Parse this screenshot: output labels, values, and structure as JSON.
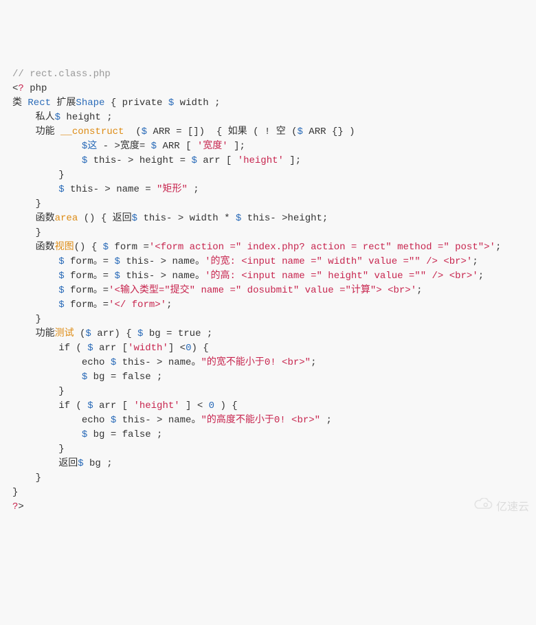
{
  "code": {
    "l01": "// rect.class.php",
    "l02a": "<",
    "l02b": "?",
    "l02c": " php",
    "l03a": "类 ",
    "l03b": "Rect",
    "l03c": " 扩展",
    "l03d": "Shape",
    "l03e": " { private ",
    "l03f": "$",
    "l03g": " width ;",
    "l04a": "    私人",
    "l04b": "$",
    "l04c": " height ;",
    "l05a": "    功能 ",
    "l05b": "__construct ",
    "l05c": " (",
    "l05d": "$",
    "l05e": " ARR = [])  { 如果 ( ! 空 (",
    "l05f": "$",
    "l05g": " ARR {} )",
    "l06a": "            ",
    "l06b": "$这",
    "l06c": " - >宽度= ",
    "l06d": "$",
    "l06e": " ARR [ ",
    "l06f": "'宽度'",
    "l06g": " ];",
    "l07a": "            ",
    "l07b": "$",
    "l07c": " this- > height = ",
    "l07d": "$",
    "l07e": " arr [ ",
    "l07f": "'height'",
    "l07g": " ];",
    "l08": "",
    "l09": "",
    "l10": "        }",
    "l11a": "        ",
    "l11b": "$",
    "l11c": " this- > name = ",
    "l11d": "\"矩形\"",
    "l11e": " ;",
    "l12": "    }",
    "l13a": "    函数",
    "l13b": "area",
    "l13c": " () { 返回",
    "l13d": "$",
    "l13e": " this- > width * ",
    "l13f": "$",
    "l13g": " this- >height;",
    "l14": "",
    "l15": "    }",
    "l16a": "    函数",
    "l16b": "视图",
    "l16c": "() { ",
    "l16d": "$",
    "l16e": " form =",
    "l16f": "'<form action =\" index.php? action = rect\" method =\" post\">'",
    "l16g": ";",
    "l17a": "        ",
    "l17b": "$",
    "l17c": " form。= ",
    "l17d": "$",
    "l17e": " this- > name。",
    "l17f": "'的宽: <input name =\" width\" value =\"\" /> <br>'",
    "l17g": ";",
    "l18a": "        ",
    "l18b": "$",
    "l18c": " form。= ",
    "l18d": "$",
    "l18e": " this- > name。",
    "l18f": "'的高: <input name =\" height\" value =\"\" /> <br>'",
    "l18g": ";",
    "l19a": "        ",
    "l19b": "$",
    "l19c": " form。=",
    "l19d": "'<输入类型=\"提交\" name =\" dosubmit\" value =\"计算\"> <br>'",
    "l19e": ";",
    "l20a": "        ",
    "l20b": "$",
    "l20c": " form。=",
    "l20d": "'</ form>'",
    "l20e": ";",
    "l21": "",
    "l22": "",
    "l23": "    }",
    "l24a": "    功能",
    "l24b": "测试 ",
    "l24c": "(",
    "l24d": "$",
    "l24e": " arr) { ",
    "l24f": "$",
    "l24g": " bg = true ;",
    "l25a": "        if ( ",
    "l25b": "$",
    "l25c": " arr [",
    "l25d": "'width'",
    "l25e": "] <",
    "l25f": "0",
    "l25g": ") {",
    "l26a": "            echo ",
    "l26b": "$",
    "l26c": " this- > name。",
    "l26d": "\"的宽不能小于0! <br>\"",
    "l26e": ";",
    "l27a": "            ",
    "l27b": "$",
    "l27c": " bg = false ;",
    "l28": "",
    "l29": "        }",
    "l30a": "        if ( ",
    "l30b": "$",
    "l30c": " arr [ ",
    "l30d": "'height'",
    "l30e": " ] < ",
    "l30f": "0",
    "l30g": " ) {",
    "l31a": "            echo ",
    "l31b": "$",
    "l31c": " this- > name。",
    "l31d": "\"的高度不能小于0! <br>\"",
    "l31e": " ;",
    "l32a": "            ",
    "l32b": "$",
    "l32c": " bg = false ;",
    "l33": "        }",
    "l34a": "        返回",
    "l34b": "$",
    "l34c": " bg ;",
    "l35": "    }",
    "l36": "}",
    "l37a": "?",
    "l37b": ">"
  },
  "watermark": "亿速云"
}
